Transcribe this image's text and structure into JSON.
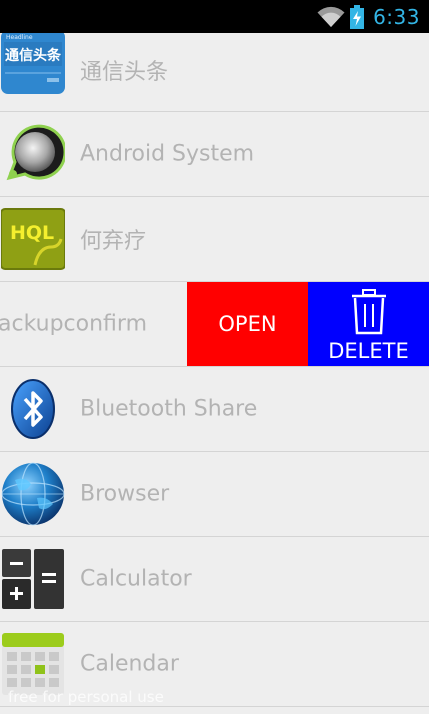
{
  "status_bar": {
    "time": "6:33",
    "wifi_icon": "wifi-icon",
    "battery_icon": "battery-charging-icon",
    "time_color": "#33b5e5"
  },
  "apps": [
    {
      "label": "通信头条",
      "icon": "tongxin-toutiao-app-icon",
      "icon_text": "通信头条",
      "icon_subtext": "Headline"
    },
    {
      "label": "Android System",
      "icon": "android-system-app-icon"
    },
    {
      "label": "何弃疗",
      "icon": "heqiliao-app-icon",
      "icon_text": "HQL"
    },
    {
      "label": "ackupconfirm",
      "icon": "none"
    },
    {
      "label": "Bluetooth Share",
      "icon": "bluetooth-app-icon"
    },
    {
      "label": "Browser",
      "icon": "browser-globe-app-icon"
    },
    {
      "label": "Calculator",
      "icon": "calculator-app-icon"
    },
    {
      "label": "Calendar",
      "icon": "calendar-app-icon"
    }
  ],
  "swipe_actions": {
    "open_label": "OPEN",
    "delete_label": "DELETE",
    "open_color": "#ff0000",
    "delete_color": "#0000ff",
    "delete_icon": "trash-icon"
  },
  "watermark": "free for personal use"
}
